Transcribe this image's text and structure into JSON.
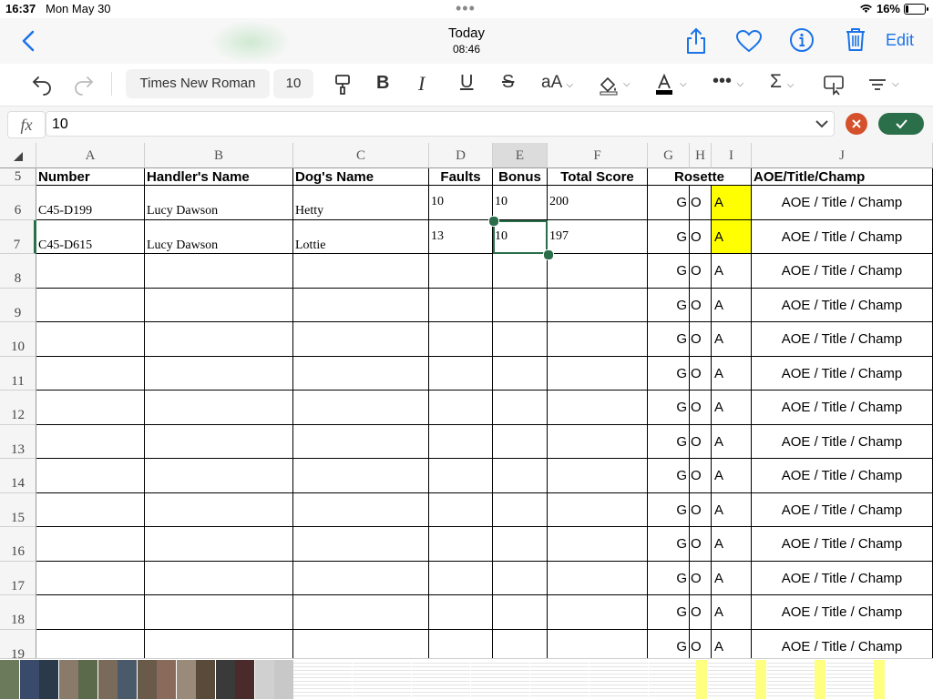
{
  "status": {
    "time": "16:37",
    "date": "Mon May 30",
    "battery": "16%"
  },
  "nav": {
    "title": "Today",
    "subtitle": "08:46",
    "edit": "Edit"
  },
  "toolbar": {
    "font": "Times New Roman",
    "size": "10",
    "case": "aA"
  },
  "formula": {
    "fx": "fx",
    "value": "10"
  },
  "columns": [
    "A",
    "B",
    "C",
    "D",
    "E",
    "F",
    "G",
    "H",
    "I",
    "J"
  ],
  "header_row": {
    "num": "5",
    "number": "Number",
    "handler": "Handler's Name",
    "dog": "Dog's Name",
    "faults": "Faults",
    "bonus": "Bonus",
    "total": "Total Score",
    "rosette": "Rosette",
    "aoe": "AOE/Title/Champ"
  },
  "rows": [
    {
      "num": "6",
      "number": "C45-D199",
      "handler": "Lucy Dawson",
      "dog": "Hetty",
      "faults": "10",
      "bonus": "10",
      "total": "200",
      "g": "G",
      "o": "O",
      "i": "A",
      "aoe": "AOE / Title / Champ"
    },
    {
      "num": "7",
      "number": "C45-D615",
      "handler": "Lucy Dawson",
      "dog": "Lottie",
      "faults": "13",
      "bonus": "10",
      "total": "197",
      "g": "G",
      "o": "O",
      "i": "A",
      "aoe": "AOE / Title / Champ"
    },
    {
      "num": "8",
      "number": "",
      "handler": "",
      "dog": "",
      "faults": "",
      "bonus": "",
      "total": "",
      "g": "G",
      "o": "O",
      "i": "A",
      "aoe": "AOE / Title / Champ"
    },
    {
      "num": "9",
      "number": "",
      "handler": "",
      "dog": "",
      "faults": "",
      "bonus": "",
      "total": "",
      "g": "G",
      "o": "O",
      "i": "A",
      "aoe": "AOE / Title / Champ"
    },
    {
      "num": "10",
      "number": "",
      "handler": "",
      "dog": "",
      "faults": "",
      "bonus": "",
      "total": "",
      "g": "G",
      "o": "O",
      "i": "A",
      "aoe": "AOE / Title / Champ"
    },
    {
      "num": "11",
      "number": "",
      "handler": "",
      "dog": "",
      "faults": "",
      "bonus": "",
      "total": "",
      "g": "G",
      "o": "O",
      "i": "A",
      "aoe": "AOE / Title / Champ"
    },
    {
      "num": "12",
      "number": "",
      "handler": "",
      "dog": "",
      "faults": "",
      "bonus": "",
      "total": "",
      "g": "G",
      "o": "O",
      "i": "A",
      "aoe": "AOE / Title / Champ"
    },
    {
      "num": "13",
      "number": "",
      "handler": "",
      "dog": "",
      "faults": "",
      "bonus": "",
      "total": "",
      "g": "G",
      "o": "O",
      "i": "A",
      "aoe": "AOE / Title / Champ"
    },
    {
      "num": "14",
      "number": "",
      "handler": "",
      "dog": "",
      "faults": "",
      "bonus": "",
      "total": "",
      "g": "G",
      "o": "O",
      "i": "A",
      "aoe": "AOE / Title / Champ"
    },
    {
      "num": "15",
      "number": "",
      "handler": "",
      "dog": "",
      "faults": "",
      "bonus": "",
      "total": "",
      "g": "G",
      "o": "O",
      "i": "A",
      "aoe": "AOE / Title / Champ"
    },
    {
      "num": "16",
      "number": "",
      "handler": "",
      "dog": "",
      "faults": "",
      "bonus": "",
      "total": "",
      "g": "G",
      "o": "O",
      "i": "A",
      "aoe": "AOE / Title / Champ"
    },
    {
      "num": "17",
      "number": "",
      "handler": "",
      "dog": "",
      "faults": "",
      "bonus": "",
      "total": "",
      "g": "G",
      "o": "O",
      "i": "A",
      "aoe": "AOE / Title / Champ"
    },
    {
      "num": "18",
      "number": "",
      "handler": "",
      "dog": "",
      "faults": "",
      "bonus": "",
      "total": "",
      "g": "G",
      "o": "O",
      "i": "A",
      "aoe": "AOE / Title / Champ"
    },
    {
      "num": "19",
      "number": "",
      "handler": "",
      "dog": "",
      "faults": "",
      "bonus": "",
      "total": "",
      "g": "G",
      "o": "O",
      "i": "A",
      "aoe": "AOE / Title / Champ"
    }
  ],
  "colors": {
    "accent": "#1a73e8",
    "selection": "#2a6e4a",
    "highlight": "#ffff00",
    "cancel": "#d4512c"
  }
}
